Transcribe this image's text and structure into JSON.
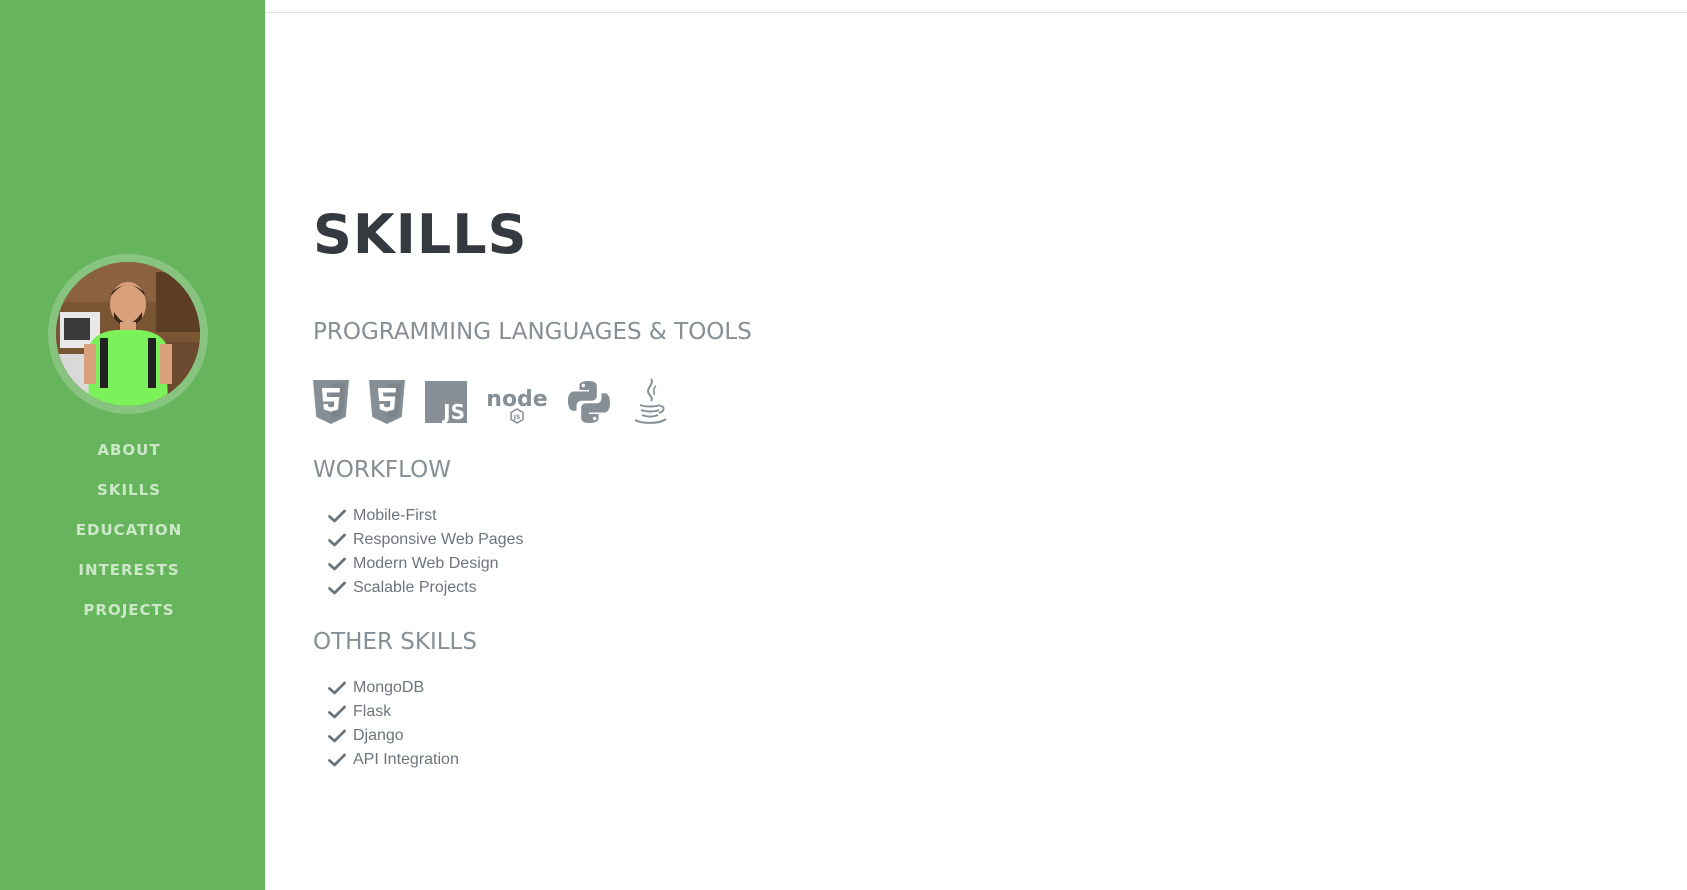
{
  "sidebar": {
    "nav": [
      {
        "label": "ABOUT"
      },
      {
        "label": "SKILLS"
      },
      {
        "label": "EDUCATION"
      },
      {
        "label": "INTERESTS"
      },
      {
        "label": "PROJECTS"
      }
    ],
    "color": "#66b45c"
  },
  "main": {
    "title": "SKILLS",
    "languages_heading": "PROGRAMMING LANGUAGES & TOOLS",
    "tool_icons": [
      "html5-icon",
      "css3-icon",
      "javascript-icon",
      "nodejs-icon",
      "python-icon",
      "java-icon"
    ],
    "nodejs_icon_text": "node",
    "js_icon_text": "JS",
    "workflow_heading": "WORKFLOW",
    "workflow_items": [
      "Mobile-First",
      "Responsive Web Pages",
      "Modern Web Design",
      "Scalable Projects"
    ],
    "other_heading": "OTHER SKILLS",
    "other_items": [
      "MongoDB",
      "Flask",
      "Django",
      "API Integration"
    ]
  },
  "colors": {
    "heading": "#343a40",
    "subheading": "#868e96",
    "icon": "#868e96",
    "nav_text": "#cde8c9"
  }
}
